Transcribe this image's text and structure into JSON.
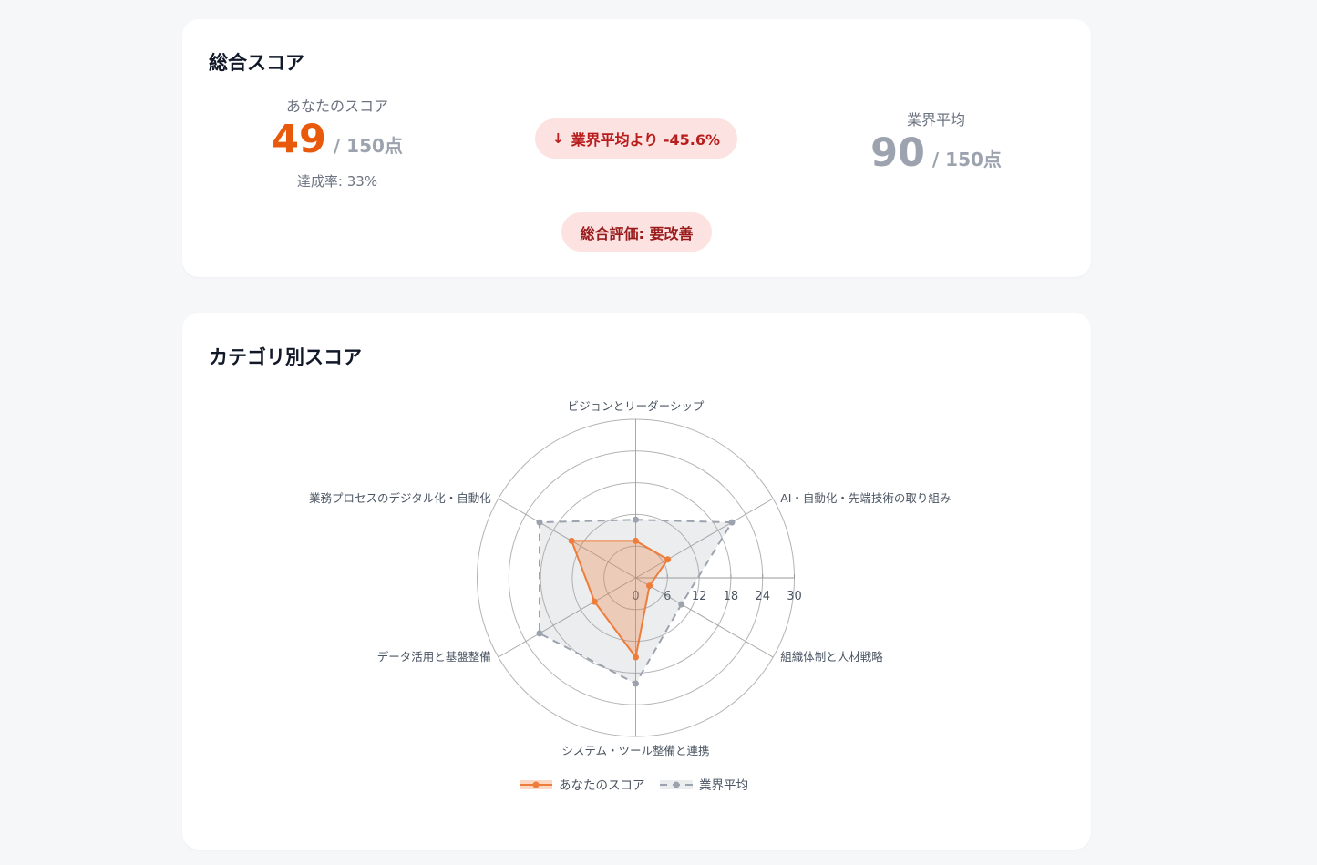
{
  "summary": {
    "title": "総合スコア",
    "your_label": "あなたのスコア",
    "your_score": "49",
    "max_text": "/ 150点",
    "achievement": "達成率: 33%",
    "avg_label": "業界平均",
    "avg_score": "90",
    "avg_max_text": "/ 150点",
    "diff_arrow": "↓",
    "diff_text": "業界平均より -45.6%",
    "evaluation": "総合評価: 要改善"
  },
  "category": {
    "title": "カテゴリ別スコア"
  },
  "colors": {
    "your": "#ee7d3b",
    "avg": "#9ca3af",
    "grid": "#9a9a9a"
  },
  "chart_data": {
    "type": "radar",
    "categories": [
      "ビジョンとリーダーシップ",
      "AI・自動化・先端技術の取り組み",
      "組織体制と人材戦略",
      "システム・ツール整備と連携",
      "データ活用と基盤整備",
      "業務プロセスのデジタル化・自動化"
    ],
    "series": [
      {
        "name": "あなたのスコア",
        "values": [
          7,
          7,
          3,
          15,
          9,
          14
        ]
      },
      {
        "name": "業界平均",
        "values": [
          11,
          21,
          10,
          20,
          21,
          21
        ]
      }
    ],
    "rlim": [
      0,
      30
    ],
    "ticks": [
      "0",
      "6",
      "12",
      "18",
      "24",
      "30"
    ],
    "legend_position": "bottom",
    "grid": true
  }
}
